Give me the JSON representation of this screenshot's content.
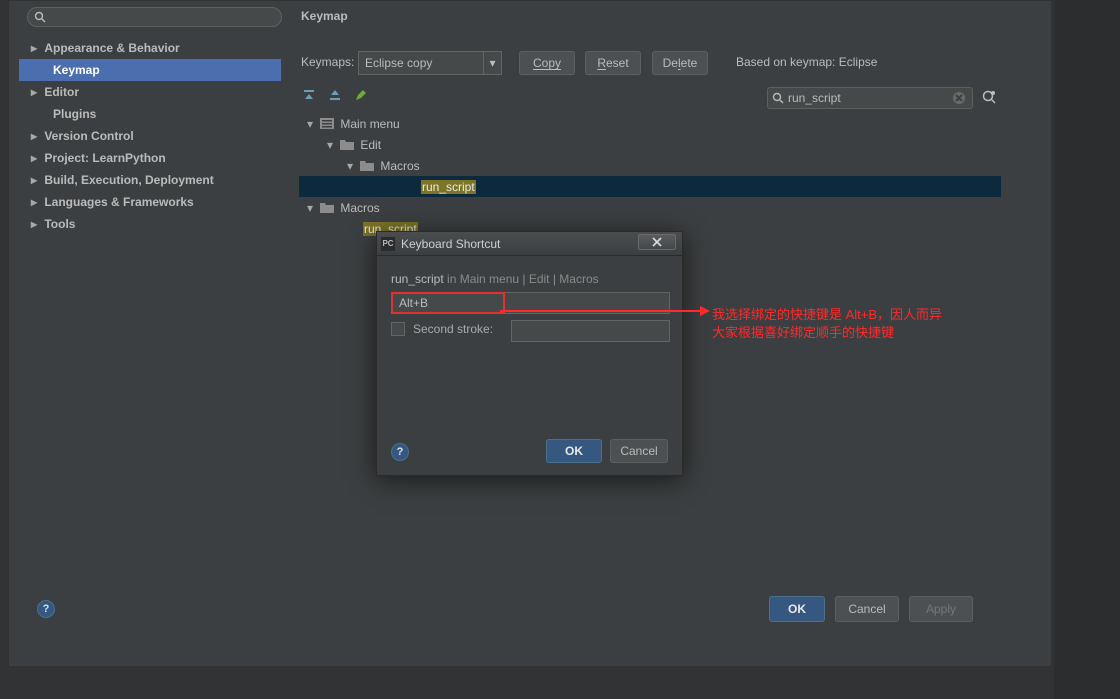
{
  "header": {
    "title": "Keymap"
  },
  "nav": {
    "items": [
      {
        "label": "Appearance & Behavior",
        "bold": true,
        "arrow": true,
        "selected": false,
        "indent": false
      },
      {
        "label": "Keymap",
        "bold": true,
        "arrow": false,
        "selected": true,
        "indent": true
      },
      {
        "label": "Editor",
        "bold": true,
        "arrow": true,
        "selected": false,
        "indent": false
      },
      {
        "label": "Plugins",
        "bold": true,
        "arrow": false,
        "selected": false,
        "indent": true
      },
      {
        "label": "Version Control",
        "bold": true,
        "arrow": true,
        "selected": false,
        "indent": false
      },
      {
        "label": "Project: LearnPython",
        "bold": true,
        "arrow": true,
        "selected": false,
        "indent": false
      },
      {
        "label": "Build, Execution, Deployment",
        "bold": true,
        "arrow": true,
        "selected": false,
        "indent": false
      },
      {
        "label": "Languages & Frameworks",
        "bold": true,
        "arrow": true,
        "selected": false,
        "indent": false
      },
      {
        "label": "Tools",
        "bold": true,
        "arrow": true,
        "selected": false,
        "indent": false
      }
    ]
  },
  "keymaps": {
    "label": "Keymaps:",
    "selected": "Eclipse copy",
    "copy": "Copy",
    "reset": "Reset",
    "delete": "Delete",
    "based": "Based on keymap: Eclipse"
  },
  "search": {
    "value": "run_script"
  },
  "tree": {
    "main_menu": "Main menu",
    "edit": "Edit",
    "macros1": "Macros",
    "run_script1": "run_script",
    "macros2": "Macros",
    "run_script2": "run_script"
  },
  "dialog": {
    "title": "Keyboard Shortcut",
    "breadcrumb": "run_script in Main menu | Edit | Macros",
    "shortcut_value": "Alt+B",
    "second_stroke_label": "Second stroke:",
    "ok": "OK",
    "cancel": "Cancel"
  },
  "annotation": {
    "line1": "我选择绑定的快捷键是 Alt+B，因人而异",
    "line2": "大家根据喜好绑定顺手的快捷键"
  },
  "footer": {
    "ok": "OK",
    "cancel": "Cancel",
    "apply": "Apply"
  }
}
